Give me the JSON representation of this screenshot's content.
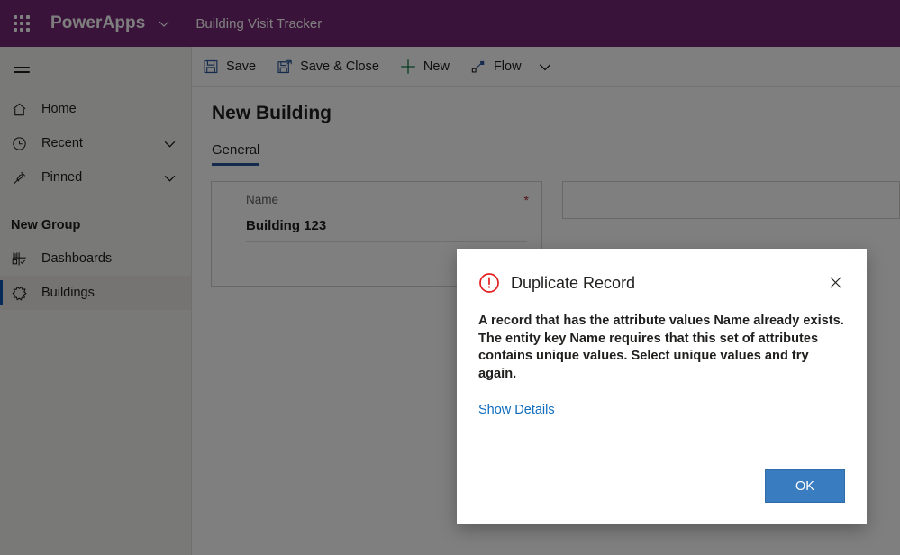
{
  "topbar": {
    "waffle_label": "app-launcher",
    "brand": "PowerApps",
    "app_name": "Building Visit Tracker"
  },
  "sidebar": {
    "group_header": "New Group",
    "items": [
      {
        "label": "Home",
        "icon": "home-icon",
        "chevron": false,
        "selected": false
      },
      {
        "label": "Recent",
        "icon": "clock-icon",
        "chevron": true,
        "selected": false
      },
      {
        "label": "Pinned",
        "icon": "pin-icon",
        "chevron": true,
        "selected": false
      }
    ],
    "group_items": [
      {
        "label": "Dashboards",
        "icon": "dashboard-icon",
        "selected": false
      },
      {
        "label": "Buildings",
        "icon": "entity-icon",
        "selected": true
      }
    ]
  },
  "commandbar": {
    "items": [
      {
        "label": "Save",
        "icon": "save-icon"
      },
      {
        "label": "Save & Close",
        "icon": "save-close-icon"
      },
      {
        "label": "New",
        "icon": "plus-icon"
      },
      {
        "label": "Flow",
        "icon": "flow-icon"
      }
    ],
    "overflow_icon": "chevron-down-icon"
  },
  "form": {
    "title": "New Building",
    "tabs": [
      {
        "label": "General",
        "active": true
      }
    ],
    "fields": [
      {
        "label": "Name",
        "value": "Building 123",
        "required": true,
        "required_marker": "*"
      }
    ]
  },
  "dialog": {
    "icon": "error-circle-icon",
    "title": "Duplicate Record",
    "close_icon": "close-icon",
    "message_lines": [
      "A record that has the attribute values Name already exists.",
      "The entity key Name requires that this set of attributes",
      "contains unique values. Select unique values and try again."
    ],
    "details_link": "Show Details",
    "ok_label": "OK"
  },
  "colors": {
    "brand_purple": "#742774",
    "accent_blue": "#2b579a",
    "link_blue": "#0f6cbd",
    "button_blue": "#3a7cc0",
    "error_red": "#e31d1d",
    "required_red": "#a4262c",
    "selected_bar": "#0f56b3"
  }
}
